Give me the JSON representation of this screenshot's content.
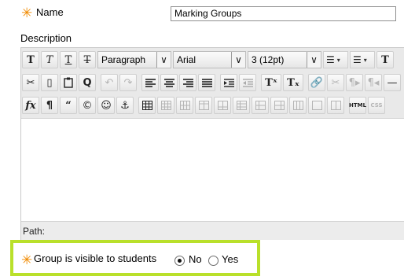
{
  "form": {
    "name_label": "Name",
    "name_value": "Marking Groups",
    "description_label": "Description",
    "required_marker": "✳",
    "accent_color": "#f08a00",
    "highlight_color": "#b9e02a"
  },
  "editor": {
    "toolbar": {
      "row1": {
        "bold": "T",
        "italic": "T",
        "underline": "T",
        "strikethrough": "T",
        "paragraph_select": "Paragraph",
        "font_select": "Arial",
        "size_select": "3 (12pt)",
        "bullet_list": "☰",
        "numbered_list": "☰",
        "text_color": "T"
      },
      "row2": {
        "cut": "✂",
        "copy": "▯",
        "paste": "📋",
        "find": "Q",
        "undo": "↶",
        "redo": "↷",
        "superscript": "Tˣ",
        "subscript": "Tₓ"
      },
      "row3": {
        "math": "fx",
        "pilcrow": "¶",
        "quote": "“",
        "copyright": "©",
        "emoticon": "☺",
        "anchor": "⚓",
        "html": "HTML",
        "css": "CSS"
      }
    },
    "path_label": "Path:"
  },
  "visibility": {
    "label": "Group is visible to students",
    "options": [
      "No",
      "Yes"
    ],
    "selected": "No"
  }
}
